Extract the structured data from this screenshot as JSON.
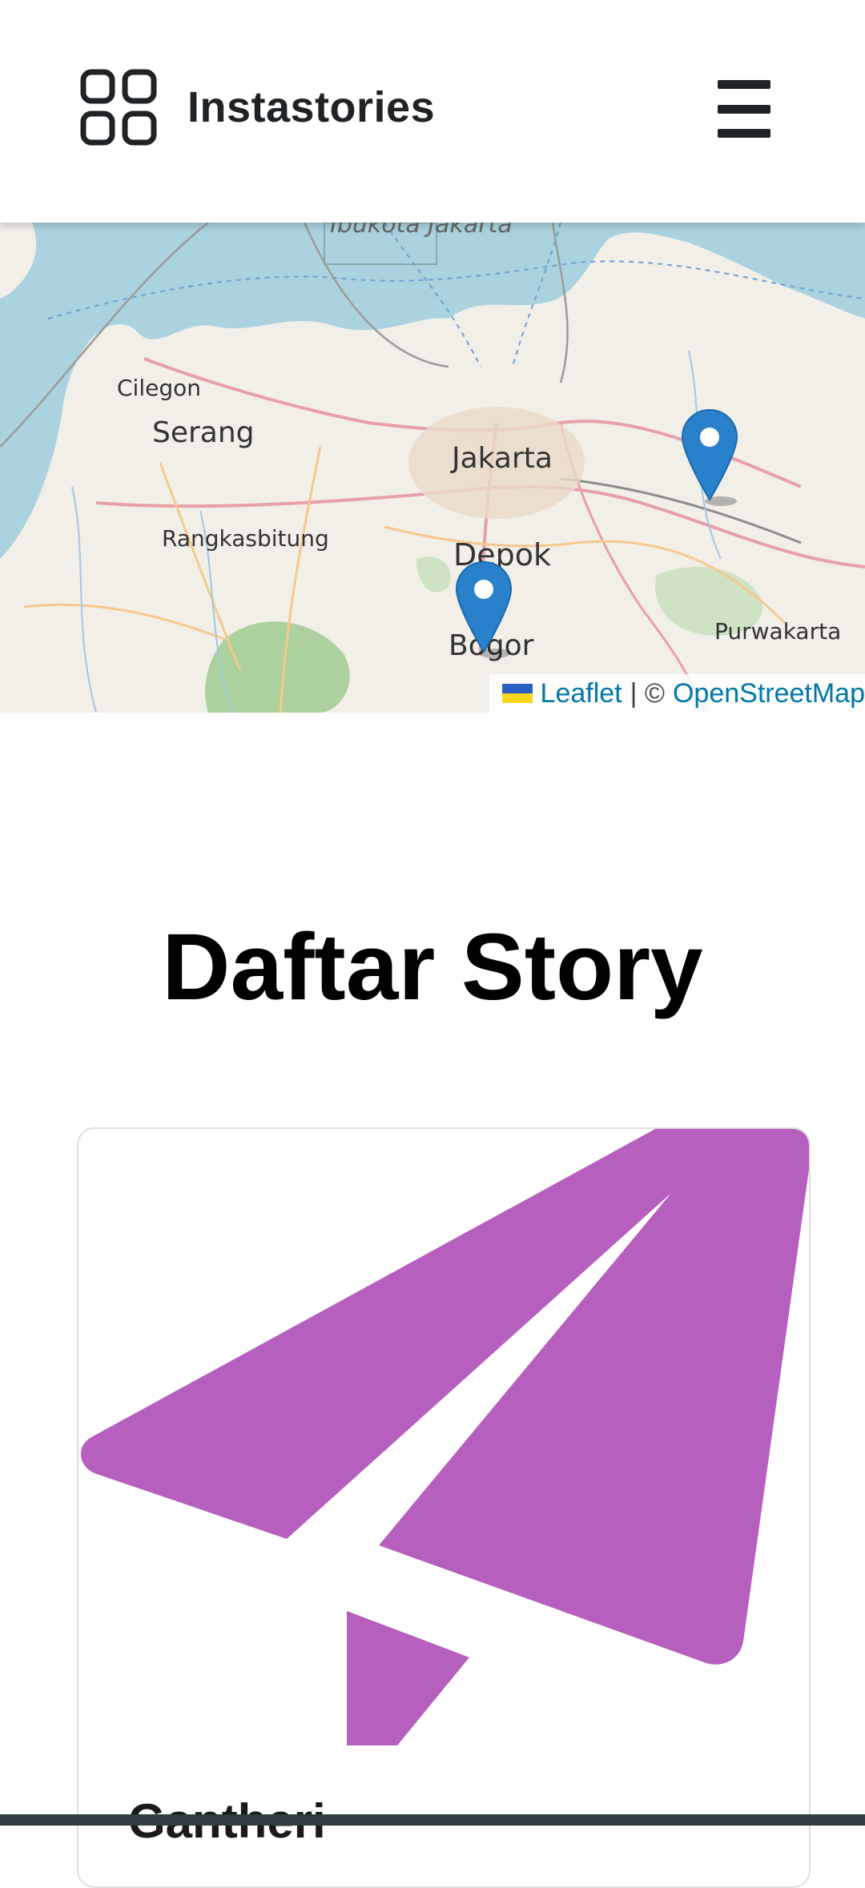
{
  "header": {
    "app_title": "Instastories"
  },
  "map": {
    "labels": {
      "top": "Ibukota Jakarta",
      "cilegon": "Cilegon",
      "serang": "Serang",
      "jakarta": "Jakarta",
      "rangkasbitung": "Rangkasbitung",
      "depok": "Depok",
      "bogor": "Bogor",
      "purwakarta": "Purwakarta"
    },
    "attribution": {
      "leaflet": "Leaflet",
      "separator": "| ©",
      "osm": "OpenStreetMap"
    },
    "colors": {
      "water": "#aad3df",
      "land": "#f2efe9",
      "marker": "#2a81cb"
    }
  },
  "main": {
    "title": "Daftar Story"
  },
  "stories": [
    {
      "name": "Gantheri",
      "image_color": "#b75fbf"
    }
  ]
}
